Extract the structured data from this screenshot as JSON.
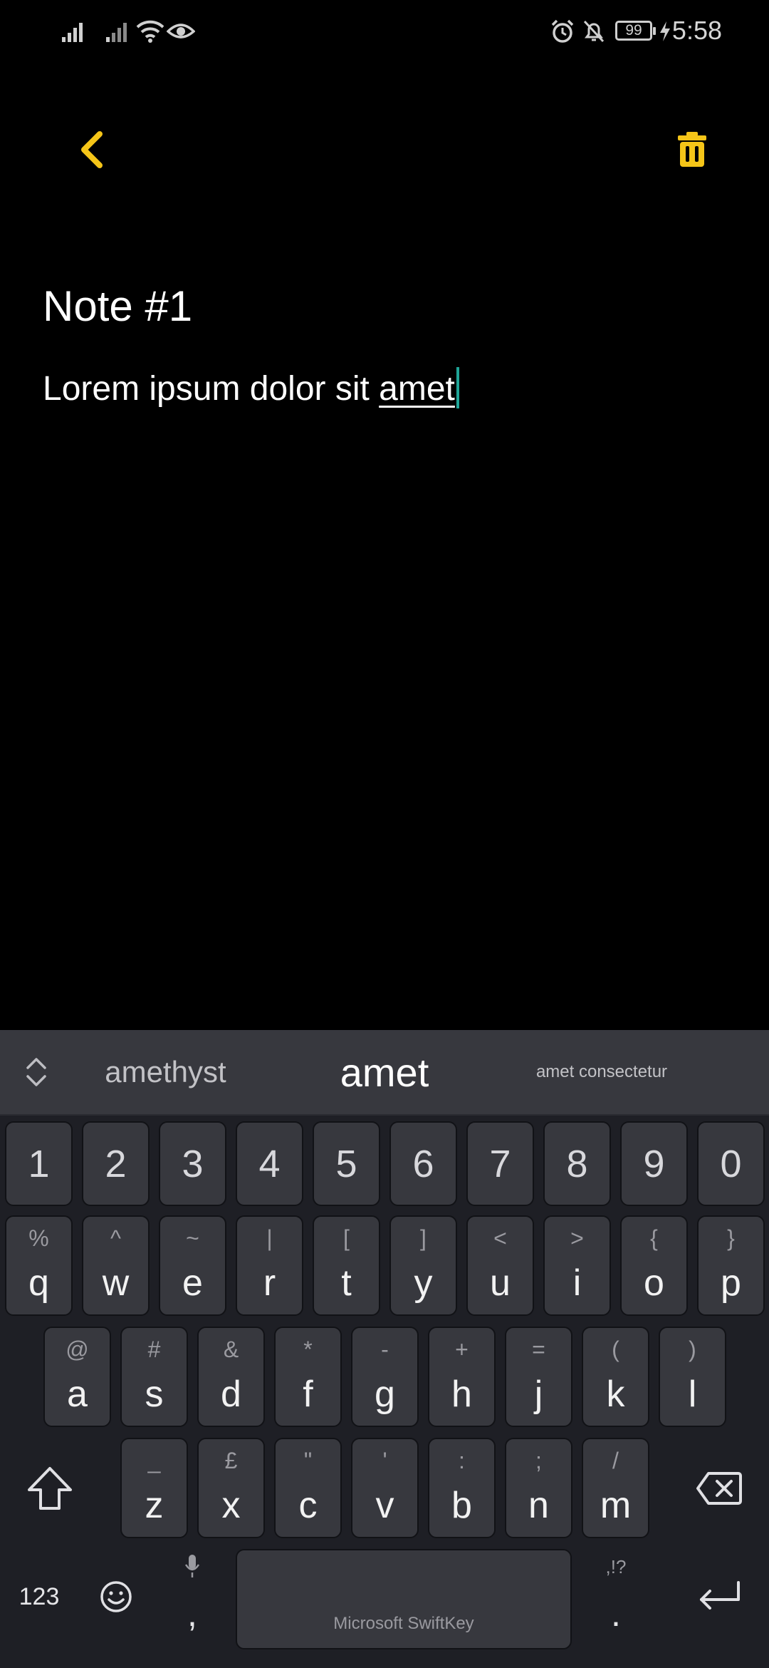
{
  "status_bar": {
    "battery": "99",
    "time": "5:58"
  },
  "app_bar": {
    "back_icon": "chevron-left-icon",
    "delete_icon": "trash-icon",
    "accent_color": "#F5C518"
  },
  "note": {
    "title": "Note #1",
    "body_prefix": "Lorem ipsum dolor sit ",
    "body_current_word": "amet"
  },
  "keyboard": {
    "suggestions": [
      "amethyst",
      "amet",
      "amet consectetur"
    ],
    "number_row": [
      "1",
      "2",
      "3",
      "4",
      "5",
      "6",
      "7",
      "8",
      "9",
      "0"
    ],
    "row1": [
      {
        "main": "q",
        "sub": "%"
      },
      {
        "main": "w",
        "sub": "^"
      },
      {
        "main": "e",
        "sub": "~"
      },
      {
        "main": "r",
        "sub": "|"
      },
      {
        "main": "t",
        "sub": "["
      },
      {
        "main": "y",
        "sub": "]"
      },
      {
        "main": "u",
        "sub": "<"
      },
      {
        "main": "i",
        "sub": ">"
      },
      {
        "main": "o",
        "sub": "{"
      },
      {
        "main": "p",
        "sub": "}"
      }
    ],
    "row2": [
      {
        "main": "a",
        "sub": "@"
      },
      {
        "main": "s",
        "sub": "#"
      },
      {
        "main": "d",
        "sub": "&"
      },
      {
        "main": "f",
        "sub": "*"
      },
      {
        "main": "g",
        "sub": "-"
      },
      {
        "main": "h",
        "sub": "+"
      },
      {
        "main": "j",
        "sub": "="
      },
      {
        "main": "k",
        "sub": "("
      },
      {
        "main": "l",
        "sub": ")"
      }
    ],
    "row3": [
      {
        "main": "z",
        "sub": "_"
      },
      {
        "main": "x",
        "sub": "£"
      },
      {
        "main": "c",
        "sub": "\""
      },
      {
        "main": "v",
        "sub": "'"
      },
      {
        "main": "b",
        "sub": ":"
      },
      {
        "main": "n",
        "sub": ";"
      },
      {
        "main": "m",
        "sub": "/"
      }
    ],
    "bottom": {
      "numbers_label": "123",
      "comma_label": ",",
      "space_label": "Microsoft SwiftKey",
      "period_label": ".",
      "period_sub": ",!?"
    }
  }
}
